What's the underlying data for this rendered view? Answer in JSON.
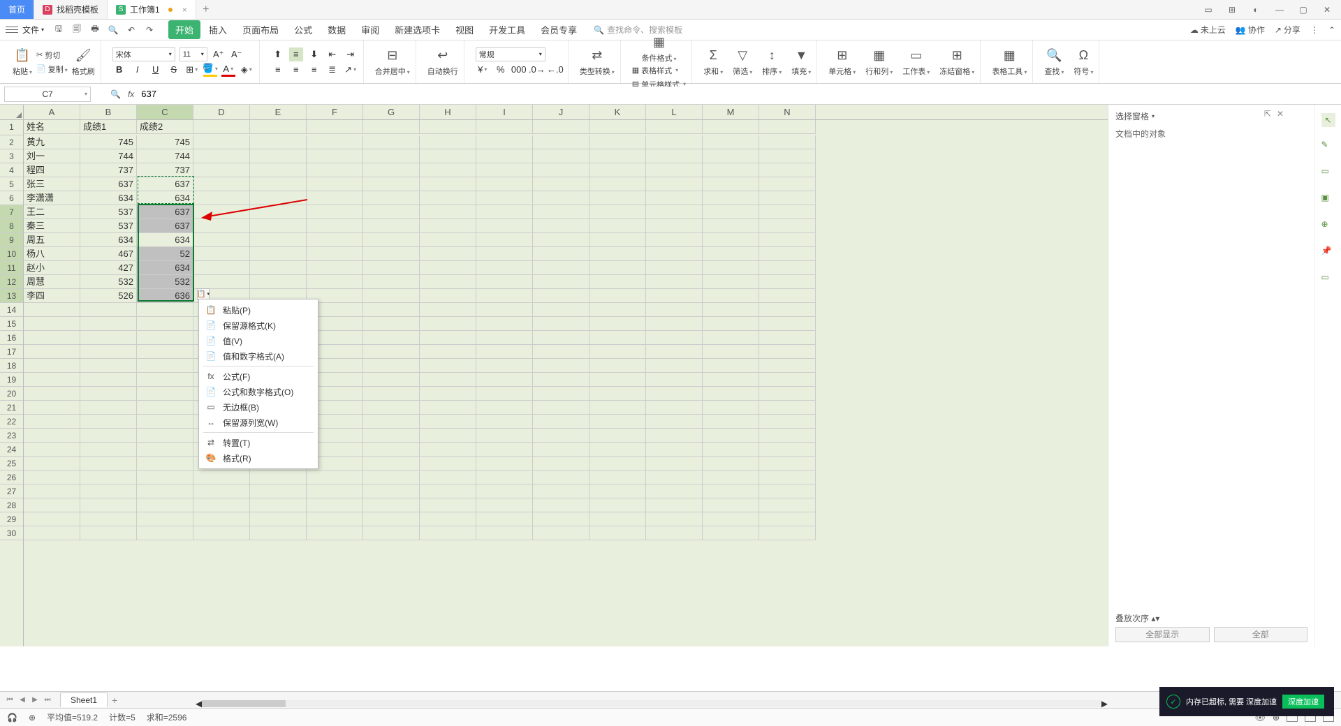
{
  "titlebar": {
    "tabs": [
      {
        "label": "首页",
        "type": "home"
      },
      {
        "label": "找稻壳模板",
        "icon": "D",
        "iconColor": "red"
      },
      {
        "label": "工作簿1",
        "icon": "S",
        "iconColor": "green",
        "modified": true
      }
    ]
  },
  "menubar": {
    "file": "文件",
    "items": [
      "开始",
      "插入",
      "页面布局",
      "公式",
      "数据",
      "审阅",
      "新建选项卡",
      "视图",
      "开发工具",
      "会员专享"
    ],
    "active": "开始",
    "search_placeholder": "查找命令、搜索模板",
    "right": {
      "cloud": "未上云",
      "coop": "协作",
      "share": "分享"
    }
  },
  "ribbon": {
    "paste": "粘贴",
    "cut": "剪切",
    "copy": "复制",
    "fmtpaint": "格式刷",
    "font": "宋体",
    "size": "11",
    "merge": "合并居中",
    "wrap": "自动换行",
    "numfmt": "常规",
    "typeconv": "类型转换",
    "condfmt": "条件格式",
    "cellstyle": "表格样式",
    "cellfmt": "单元格样式",
    "sum": "求和",
    "filter": "筛选",
    "sort": "排序",
    "fill": "填充",
    "cells": "单元格",
    "rowcol": "行和列",
    "sheet": "工作表",
    "freeze": "冻结窗格",
    "tabletool": "表格工具",
    "find": "查找",
    "symbol": "符号"
  },
  "formula": {
    "name": "C7",
    "value": "637"
  },
  "columns": [
    "A",
    "B",
    "C",
    "D",
    "E",
    "F",
    "G",
    "H",
    "I",
    "J",
    "K",
    "L",
    "M",
    "N"
  ],
  "rows_shown": 30,
  "table": {
    "headers": [
      "姓名",
      "成绩1",
      "成绩2"
    ],
    "rows": [
      [
        "黄九",
        745,
        745
      ],
      [
        "刘一",
        744,
        744
      ],
      [
        "程四",
        737,
        737
      ],
      [
        "张三",
        637,
        637
      ],
      [
        "李潇潇",
        634,
        634
      ],
      [
        "王二",
        537,
        637
      ],
      [
        "秦三",
        537,
        637
      ],
      [
        "周五",
        634,
        634
      ],
      [
        "杨八",
        467,
        52
      ],
      [
        "赵小",
        427,
        634
      ],
      [
        "周慧",
        532,
        532
      ],
      [
        "李四",
        526,
        636
      ]
    ]
  },
  "selection": {
    "col": "C",
    "rows_sel": [
      7,
      13
    ],
    "active_row": 7,
    "copy_src": [
      5,
      6
    ],
    "highlight_rows": [
      7,
      8,
      10,
      11,
      12,
      13
    ]
  },
  "context_menu": {
    "items": [
      {
        "label": "粘贴(P)",
        "icon": "📋"
      },
      {
        "label": "保留源格式(K)",
        "icon": "📄"
      },
      {
        "label": "值(V)",
        "icon": "📄"
      },
      {
        "label": "值和数字格式(A)",
        "icon": "📄"
      },
      "---",
      {
        "label": "公式(F)",
        "icon": "fx"
      },
      {
        "label": "公式和数字格式(O)",
        "icon": "📄"
      },
      {
        "label": "无边框(B)",
        "icon": "▭"
      },
      {
        "label": "保留源列宽(W)",
        "icon": "↔"
      },
      "---",
      {
        "label": "转置(T)",
        "icon": "⇄"
      },
      {
        "label": "格式(R)",
        "icon": "🎨"
      }
    ]
  },
  "right_panel": {
    "title": "选择窗格",
    "sub": "文档中的对象",
    "order": "叠放次序",
    "show_all": "全部显示",
    "hide_all": "全部"
  },
  "sheet_tabs": {
    "active": "Sheet1"
  },
  "statusbar": {
    "avg": "平均值=519.2",
    "count": "计数=5",
    "sum": "求和=2596"
  },
  "toast": {
    "text": "内存已超标, 需要 深度加速",
    "btn": "深度加速"
  }
}
